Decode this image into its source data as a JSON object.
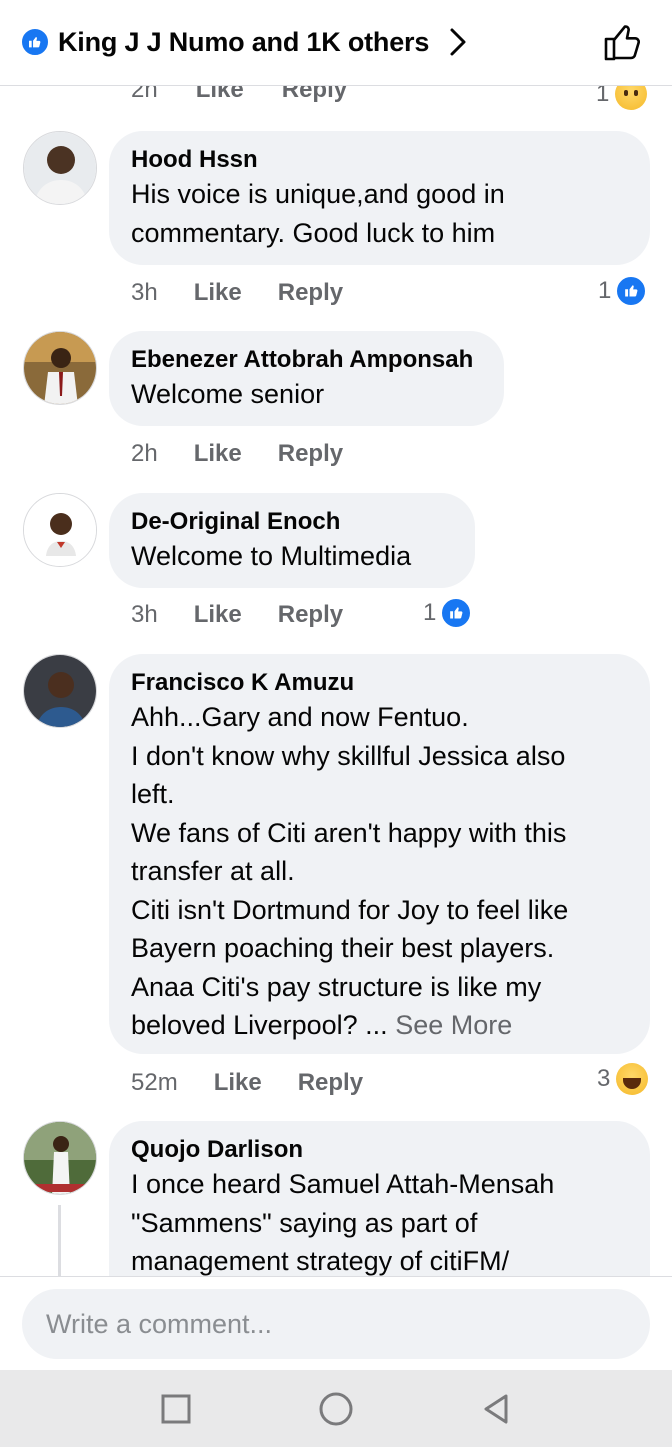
{
  "header": {
    "title": "King J J Numo and 1K others",
    "icons": [
      "like-badge-icon",
      "chevron-right-icon",
      "thumbs-up-icon"
    ]
  },
  "previous_comment": {
    "time": "2h",
    "like_label": "Like",
    "reply_label": "Reply",
    "reaction_count": "1"
  },
  "comments": [
    {
      "author": "Hood Hssn",
      "text": "His voice is unique,and good in\ncommentary. Good luck to him",
      "time": "3h",
      "like_label": "Like",
      "reply_label": "Reply",
      "reaction_count": "1",
      "reaction": "like"
    },
    {
      "author": "Ebenezer Attobrah Amponsah",
      "text": "Welcome senior",
      "time": "2h",
      "like_label": "Like",
      "reply_label": "Reply"
    },
    {
      "author": "De-Original Enoch",
      "text": "Welcome to Multimedia",
      "time": "3h",
      "like_label": "Like",
      "reply_label": "Reply",
      "reaction_count": "1",
      "reaction": "like"
    },
    {
      "author": "Francisco K Amuzu",
      "text": "Ahh...Gary and now Fentuo.\nI don't know why skillful Jessica also\nleft.\nWe fans of Citi aren't happy with this\ntransfer at all.\nCiti isn't Dortmund for Joy to feel like\nBayern poaching their best players.\nAnaa Citi's pay structure is like my\nbeloved Liverpool? ...",
      "see_more": "See More",
      "time": "52m",
      "like_label": "Like",
      "reply_label": "Reply",
      "reaction_count": "3",
      "reaction": "haha"
    },
    {
      "author": "Quojo Darlison",
      "text": "I once heard Samuel Attah-Mensah\n\"Sammens\" saying as part of\nmanagement strategy of citiFM/"
    }
  ],
  "composer": {
    "placeholder": "Write a comment..."
  },
  "navbar": {
    "buttons": [
      "recent-apps",
      "home",
      "back"
    ]
  },
  "colors": {
    "accent": "#1877f2",
    "bubble": "#f0f2f5",
    "muted": "#65676b"
  }
}
